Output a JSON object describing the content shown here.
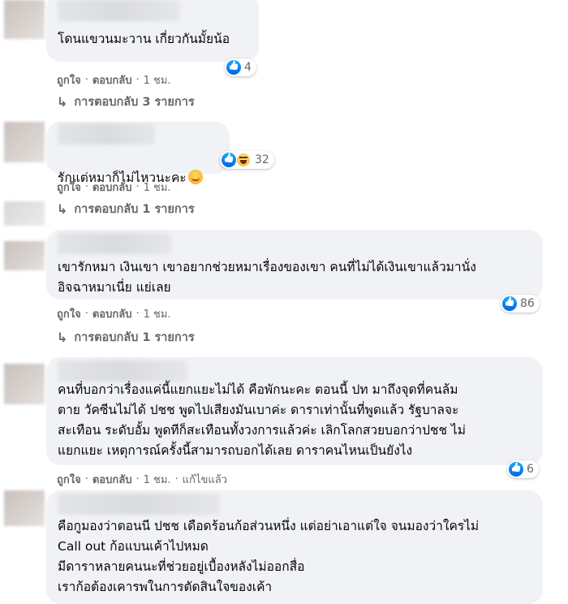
{
  "comments": [
    {
      "text": "โดนแขวนมะวาน เกี่ยวกันมั้ยน้อ",
      "reaction_count": "4",
      "actions": {
        "like": "ถูกใจ",
        "reply": "ตอบกลับ",
        "time": "1 ชม."
      },
      "replies_label": "การตอบกลับ 3 รายการ"
    },
    {
      "text": "รักแต่หมาก็ไม่ไหวนะคะ",
      "reaction_count": "32",
      "actions": {
        "like": "ถูกใจ",
        "reply": "ตอบกลับ",
        "time": "1 ชม."
      },
      "replies_label": "การตอบกลับ 1 รายการ"
    },
    {
      "text": "เขารักหมา เงินเขา เขาอยากช่วยหมาเรื่องของเขา คนที่ไม่ได้เงินเขาแล้วมานั่ง\nอิจฉาหมาเนี่ย แย่เลย",
      "reaction_count": "86",
      "actions": {
        "like": "ถูกใจ",
        "reply": "ตอบกลับ",
        "time": "1 ชม."
      },
      "replies_label": "การตอบกลับ 1 รายการ"
    },
    {
      "text": "คนที่บอกว่าเรื่องแค่นี้แยกแยะไม่ได้ คือพักนะคะ ตอนนี้ ปท มาถึงจุดที่คนล้ม\nตาย วัคซีนไม่ได้ ปชช พูดไปเสียงมันเบาค่ะ ดาราเท่านั้นที่พูดแล้ว รัฐบาลจะ\nสะเทือน ระดับอั้ม พูดทีก็สะเทือนทั้งวงการแล้วค่ะ เลิกโลกสวยบอกว่าปชช ไม่\nแยกแยะ เหตุการณ์ครั้งนี้สามารถบอกได้เลย ดาราคนไหนเป็นยังไง",
      "reaction_count": "6",
      "actions": {
        "like": "ถูกใจ",
        "reply": "ตอบกลับ",
        "time": "1 ชม.",
        "edited": "แก้ไขแล้ว"
      }
    },
    {
      "text": "คือกูมองว่าตอนนี ปชช เดือดร้อนก้อส่วนหนึ่ง แต่อย่าเอาแต่ใจ จนมองว่าใครไม่\nCall out ก้อแบนเค้าไปหมด\nมีดาราหลายคนนะที่ช่วยอยู่เบื้องหลังไม่ออกสื่อ\nเราก้อต้องเคารพในการตัดสินใจของเค้า"
    }
  ],
  "icons": {
    "like": "like-reaction-icon",
    "haha": "haha-reaction-icon",
    "reply_arrow": "reply-arrow-icon"
  },
  "colors": {
    "bubble": "#f0f2f5",
    "meta_text": "#65676b",
    "like_blue": "#0866ff"
  }
}
